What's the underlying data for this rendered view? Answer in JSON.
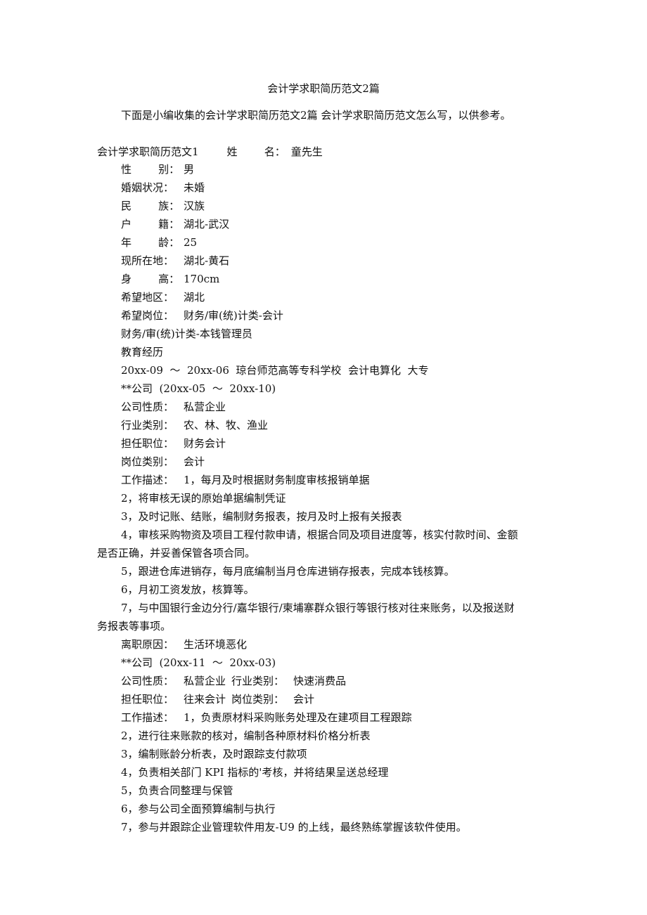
{
  "document": {
    "title": "会计学求职简历范文2篇",
    "intro": "下面是小编收集的会计学求职简历范文2篇  会计学求职简历范文怎么写，以供参考。",
    "resume1": {
      "heading": "会计学求职简历范文1",
      "name_label": "姓        名：",
      "name_value": "童先生",
      "fields": [
        {
          "label": "性        别：",
          "value": "男"
        },
        {
          "label": "婚姻状况：",
          "value": "未婚"
        },
        {
          "label": "民        族：",
          "value": "汉族"
        },
        {
          "label": "户        籍：",
          "value": "湖北-武汉"
        },
        {
          "label": "年        龄：",
          "value": "25"
        },
        {
          "label": "现所在地：",
          "value": "湖北-黄石"
        },
        {
          "label": "身        高：",
          "value": "170cm"
        },
        {
          "label": "希望地区：",
          "value": "湖北"
        },
        {
          "label": "希望岗位：",
          "value": "财务/审(统)计类-会计"
        }
      ],
      "extra_position": "财务/审(统)计类-本钱管理员",
      "education_heading": "教育经历",
      "education": "20xx-09  ～  20xx-06  琼台师范高等专科学校  会计电算化  大专",
      "job1": {
        "header": "**公司  (20xx-05  ～  20xx-10)",
        "fields": [
          {
            "label": "公司性质：",
            "value": "私营企业"
          },
          {
            "label": "行业类别：",
            "value": "农、林、牧、渔业"
          },
          {
            "label": "担任职位：",
            "value": "财务会计"
          },
          {
            "label": "岗位类别：",
            "value": "会计"
          },
          {
            "label": "工作描述：",
            "value": "1，每月及时根据财务制度审核报销单据"
          }
        ],
        "duties": [
          "2，将审核无误的原始单据编制凭证",
          "3，及时记账、结账，编制财务报表，按月及时上报有关报表",
          "4，审核采购物资及项目工程付款申请，根据合同及项目进度等，核实付款时间、金额",
          "是否正确，并妥善保管各项合同。",
          "5，跟进仓库进销存，每月底编制当月仓库进销存报表，完成本钱核算。",
          "6，月初工资发放，核算等。",
          "7，与中国银行金边分行/嘉华银行/柬埔寨群众银行等银行核对往来账务，以及报送财",
          "务报表等事项。"
        ],
        "leave_label": "离职原因：",
        "leave_value": "生活环境恶化"
      },
      "job2": {
        "header": "**公司  (20xx-11  ～  20xx-03)",
        "line1_label": "公司性质：",
        "line1_value": "私营企业",
        "line1_label2": "行业类别：",
        "line1_value2": "快速消费品",
        "line2_label": "担任职位：",
        "line2_value": "往来会计",
        "line2_label2": "岗位类别：",
        "line2_value2": "会计",
        "desc_label": "工作描述：",
        "desc_value": "1，负责原材料采购账务处理及在建项目工程跟踪",
        "duties": [
          "2，进行往来账款的核对，编制各种原材料价格分析表",
          "3，编制账龄分析表，及时跟踪支付款项",
          "4，负责相关部门 KPI 指标的'考核，并将结果呈送总经理",
          "5，负责合同整理与保管",
          "6，参与公司全面预算编制与执行",
          "7，参与并跟踪企业管理软件用友-U9 的上线，最终熟练掌握该软件使用。"
        ]
      }
    }
  }
}
